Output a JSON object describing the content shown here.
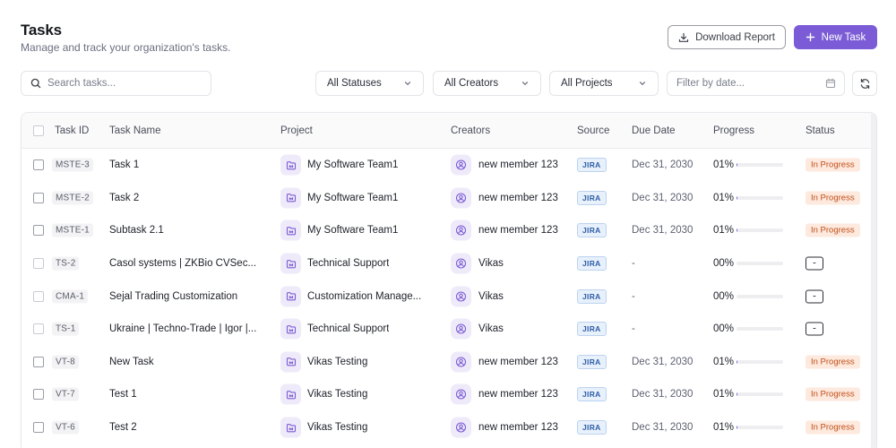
{
  "header": {
    "title": "Tasks",
    "subtitle": "Manage and track your organization's tasks.",
    "download_label": "Download Report",
    "new_task_label": "New Task"
  },
  "filters": {
    "search_placeholder": "Search tasks...",
    "status": "All Statuses",
    "creators": "All Creators",
    "projects": "All Projects",
    "date_placeholder": "Filter by date..."
  },
  "table": {
    "columns": [
      "Task ID",
      "Task Name",
      "Project",
      "Creators",
      "Source",
      "Due Date",
      "Progress",
      "Status"
    ],
    "rows": [
      {
        "id": "MSTE-3",
        "name": "Task 1",
        "project": "My Software Team1",
        "creator": "new member 123",
        "source": "JIRA",
        "due": "Dec 31, 2030",
        "progress": "01%",
        "progress_value": 0.01,
        "status": "In Progress"
      },
      {
        "id": "MSTE-2",
        "name": "Task 2",
        "project": "My Software Team1",
        "creator": "new member 123",
        "source": "JIRA",
        "due": "Dec 31, 2030",
        "progress": "01%",
        "progress_value": 0.01,
        "status": "In Progress"
      },
      {
        "id": "MSTE-1",
        "name": "Subtask 2.1",
        "project": "My Software Team1",
        "creator": "new member 123",
        "source": "JIRA",
        "due": "Dec 31, 2030",
        "progress": "01%",
        "progress_value": 0.01,
        "status": "In Progress"
      },
      {
        "id": "TS-2",
        "name": "Casol systems | ZKBio CVSec...",
        "project": "Technical Support",
        "creator": "Vikas",
        "source": "JIRA",
        "due": "-",
        "progress": "00%",
        "progress_value": 0,
        "status": "-"
      },
      {
        "id": "CMA-1",
        "name": "Sejal Trading Customization",
        "project": "Customization Manage...",
        "creator": "Vikas",
        "source": "JIRA",
        "due": "-",
        "progress": "00%",
        "progress_value": 0,
        "status": "-"
      },
      {
        "id": "TS-1",
        "name": "Ukraine | Techno-Trade | Igor |...",
        "project": "Technical Support",
        "creator": "Vikas",
        "source": "JIRA",
        "due": "-",
        "progress": "00%",
        "progress_value": 0,
        "status": "-"
      },
      {
        "id": "VT-8",
        "name": "New Task",
        "project": "Vikas Testing",
        "creator": "new member 123",
        "source": "JIRA",
        "due": "Dec 31, 2030",
        "progress": "01%",
        "progress_value": 0.01,
        "status": "In Progress"
      },
      {
        "id": "VT-7",
        "name": "Test 1",
        "project": "Vikas Testing",
        "creator": "new member 123",
        "source": "JIRA",
        "due": "Dec 31, 2030",
        "progress": "01%",
        "progress_value": 0.01,
        "status": "In Progress"
      },
      {
        "id": "VT-6",
        "name": "Test 2",
        "project": "Vikas Testing",
        "creator": "new member 123",
        "source": "JIRA",
        "due": "Dec 31, 2030",
        "progress": "01%",
        "progress_value": 0.01,
        "status": "In Progress"
      }
    ]
  },
  "icons": {
    "download": "download-icon",
    "new_task": "plus-icon",
    "search": "search-icon",
    "select": "chevron-down-icon",
    "date": "calendar-icon",
    "refresh": "refresh-icon",
    "project": "folder-icon",
    "creator": "user-circle-icon"
  },
  "colors": {
    "accent": "#7b5cd6",
    "status_in_progress_bg": "#fde9dd",
    "status_in_progress_text": "#c2501b",
    "source_bg": "#e7f0fb",
    "source_text": "#2f5fa8"
  }
}
